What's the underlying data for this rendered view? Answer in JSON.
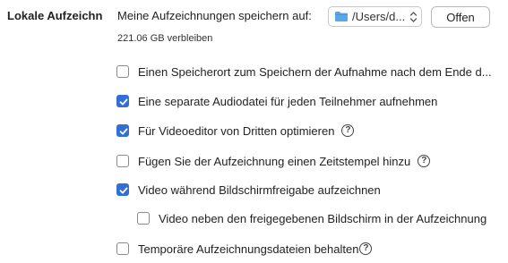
{
  "section": {
    "title": "Lokale Aufzeichn"
  },
  "location": {
    "label": "Meine Aufzeichnungen speichern auf:",
    "path": "/Users/d...",
    "open_label": "Offen",
    "free_space": "221.06 GB verbleiben"
  },
  "options": [
    {
      "label": "Einen Speicherort zum Speichern der Aufnahme nach dem Ende d...",
      "checked": false,
      "help": false
    },
    {
      "label": "Eine separate Audiodatei für jeden Teilnehmer aufnehmen",
      "checked": true,
      "help": false
    },
    {
      "label": "Für Videoeditor von Dritten optimieren",
      "checked": true,
      "help": true
    },
    {
      "label": "Fügen Sie der Aufzeichnung einen Zeitstempel hinzu",
      "checked": false,
      "help": true
    },
    {
      "label": "Video während Bildschirmfreigabe aufzeichnen",
      "checked": true,
      "help": false
    },
    {
      "label": "Video neben den freigegebenen Bildschirm in der Aufzeichnung",
      "checked": false,
      "help": false
    },
    {
      "label": "Temporäre Aufzeichnungsdateien behalten",
      "checked": false,
      "help": true
    }
  ],
  "help_glyph": "?",
  "icons": {
    "folder": "folder-icon",
    "chevron": "updown-chevron-icon",
    "check": "checkmark-icon",
    "help": "question-circle-icon"
  },
  "colors": {
    "accent": "#2f6fd6",
    "folder": "#5aa7e8"
  }
}
